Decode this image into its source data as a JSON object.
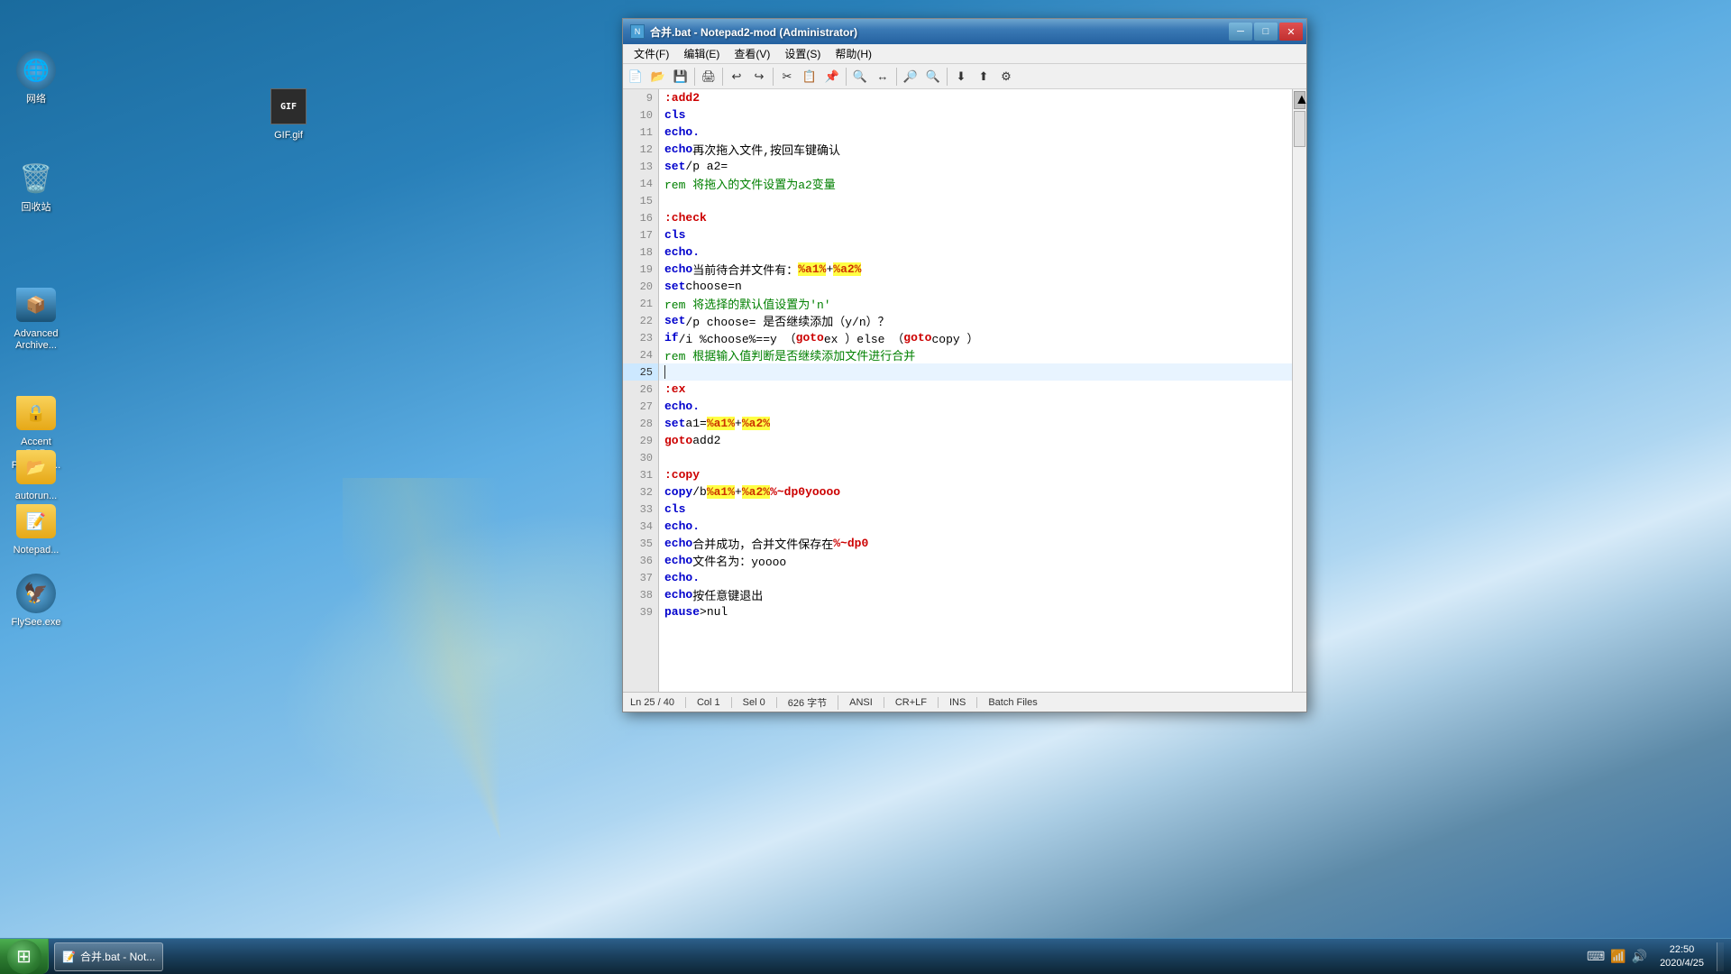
{
  "desktop": {
    "background_color": "#1a5276"
  },
  "taskbar": {
    "start_label": "开始",
    "taskbar_items": [
      {
        "id": "notepad-task",
        "label": "合并.bat - Not...",
        "icon": "📝",
        "active": true
      }
    ],
    "tray": {
      "time": "22:50",
      "date": "2020/4/25"
    }
  },
  "desktop_icons": [
    {
      "id": "icon-wanglo",
      "label": "网络",
      "icon_type": "network"
    },
    {
      "id": "icon-recycle",
      "label": "回收站",
      "icon_type": "recycle"
    },
    {
      "id": "icon-archive",
      "label": "Advanced Archive...",
      "icon_type": "folder_archive"
    },
    {
      "id": "icon-accent",
      "label": "Accent RAR Password...",
      "icon_type": "folder_accent"
    },
    {
      "id": "icon-autorun",
      "label": "autorun...",
      "icon_type": "folder_autorun"
    },
    {
      "id": "icon-notepad",
      "label": "Notepad...",
      "icon_type": "folder_notepad"
    },
    {
      "id": "icon-flysee",
      "label": "FlySee.exe",
      "icon_type": "exe_flysee"
    },
    {
      "id": "icon-gif",
      "label": "GIF.gif",
      "icon_type": "gif_file"
    }
  ],
  "notepad_window": {
    "title": "合并.bat - Notepad2-mod (Administrator)",
    "menu_items": [
      "文件(F)",
      "编辑(E)",
      "查看(V)",
      "设置(S)",
      "帮助(H)"
    ],
    "status": {
      "position": "Ln 25 / 40",
      "col": "Col 1",
      "sel": "Sel 0",
      "chars": "626 字节",
      "encoding": "ANSI",
      "line_ending": "CR+LF",
      "insert": "INS",
      "file_type": "Batch Files"
    },
    "lines": [
      {
        "num": 9,
        "content": ":add2",
        "type": "label"
      },
      {
        "num": 10,
        "content": "cls",
        "type": "keyword"
      },
      {
        "num": 11,
        "content": "echo.",
        "type": "keyword"
      },
      {
        "num": 12,
        "content": "echo 再次拖入文件,按回车键确认",
        "type": "keyword"
      },
      {
        "num": 13,
        "content": "set /p a2=",
        "type": "keyword"
      },
      {
        "num": 14,
        "content": "rem 将拖入的文件设置为a2变量",
        "type": "rem"
      },
      {
        "num": 15,
        "content": "",
        "type": "empty"
      },
      {
        "num": 16,
        "content": ":check",
        "type": "label"
      },
      {
        "num": 17,
        "content": "cls",
        "type": "keyword"
      },
      {
        "num": 18,
        "content": "echo.",
        "type": "keyword"
      },
      {
        "num": 19,
        "content": "echo 当前待合并文件有：%a1% + %a2%",
        "type": "keyword_highlight"
      },
      {
        "num": 20,
        "content": "set choose=n",
        "type": "keyword"
      },
      {
        "num": 21,
        "content": "rem 将选择的默认值设置为'n'",
        "type": "rem"
      },
      {
        "num": 22,
        "content": "set /p choose= 是否继续添加（y/n）？",
        "type": "keyword"
      },
      {
        "num": 23,
        "content": "if /i %choose%==y （ goto ex ）else （ goto copy ）",
        "type": "if_line"
      },
      {
        "num": 24,
        "content": "rem 根据输入值判断是否继续添加文件进行合并",
        "type": "rem"
      },
      {
        "num": 25,
        "content": "",
        "type": "current"
      },
      {
        "num": 26,
        "content": ":ex",
        "type": "label"
      },
      {
        "num": 27,
        "content": "echo.",
        "type": "keyword"
      },
      {
        "num": 28,
        "content": "set a1= %a1% + %a2%",
        "type": "keyword_highlight2"
      },
      {
        "num": 29,
        "content": "goto add2",
        "type": "keyword"
      },
      {
        "num": 30,
        "content": "",
        "type": "empty"
      },
      {
        "num": 31,
        "content": ":copy",
        "type": "label"
      },
      {
        "num": 32,
        "content": "copy /b %a1% + %a2% %~dp0yoooo",
        "type": "keyword_highlight3"
      },
      {
        "num": 33,
        "content": "cls",
        "type": "keyword"
      },
      {
        "num": 34,
        "content": "echo.",
        "type": "keyword"
      },
      {
        "num": 35,
        "content": "echo 合并成功，合并文件保存在%~dp0",
        "type": "keyword_highlight4"
      },
      {
        "num": 36,
        "content": "echo 文件名为：yoooo",
        "type": "keyword"
      },
      {
        "num": 37,
        "content": "echo.",
        "type": "keyword"
      },
      {
        "num": 38,
        "content": "echo 按任意键退出",
        "type": "keyword"
      },
      {
        "num": 39,
        "content": "pause>nul",
        "type": "keyword"
      }
    ]
  }
}
